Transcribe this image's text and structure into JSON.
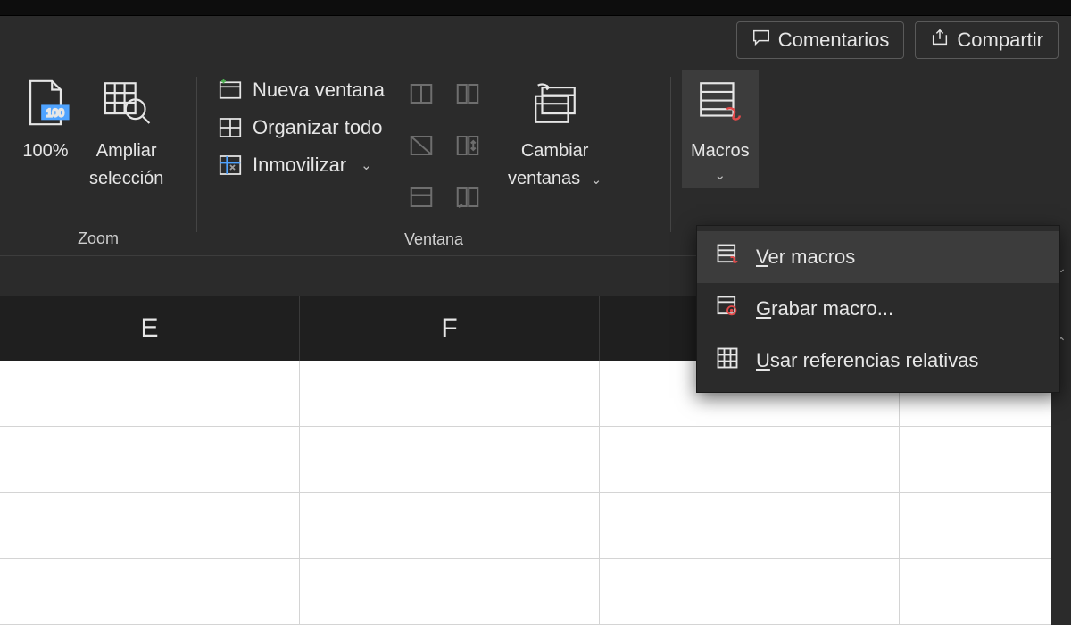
{
  "header": {
    "comments": "Comentarios",
    "share": "Compartir"
  },
  "ribbon": {
    "zoom": {
      "label": "Zoom",
      "pct_label": "100%",
      "expand_label_line1": "Ampliar",
      "expand_label_line2": "selección"
    },
    "window": {
      "label": "Ventana",
      "new_window": "Nueva ventana",
      "arrange_all": "Organizar todo",
      "freeze": "Inmovilizar",
      "switch_line1": "Cambiar",
      "switch_line2": "ventanas"
    },
    "macros": {
      "label": "Macros"
    }
  },
  "columns": [
    "E",
    "F",
    ""
  ],
  "dropdown": {
    "view_macros": "er macros",
    "view_macros_accel": "V",
    "record_macro": "rabar macro...",
    "record_macro_accel": "G",
    "use_relative": "sar referencias relativas",
    "use_relative_accel": "U"
  }
}
